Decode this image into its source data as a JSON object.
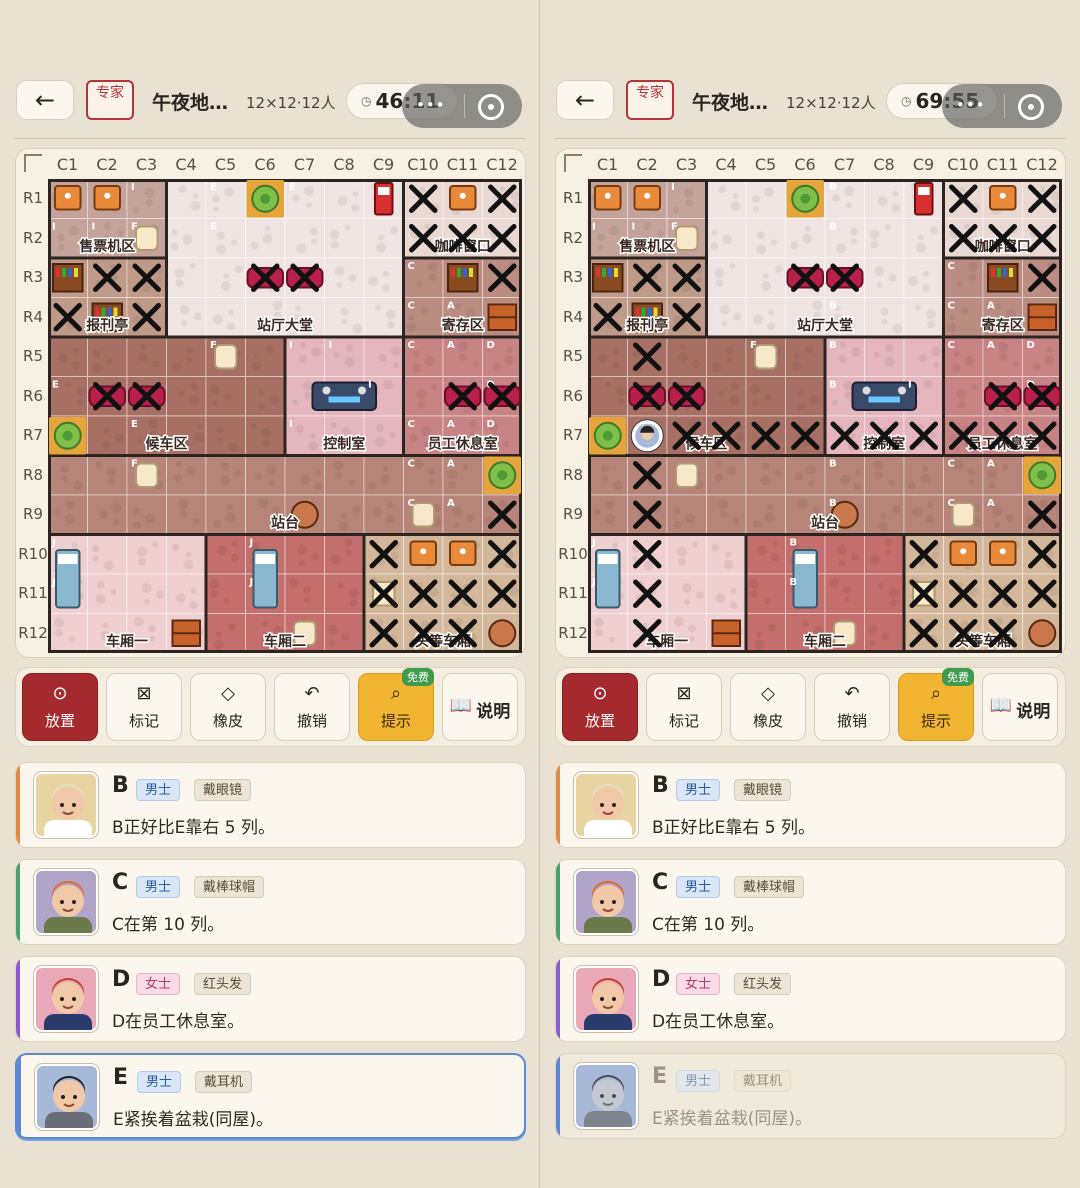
{
  "header": {
    "back_icon": "←",
    "difficulty": "专家",
    "title": "午夜地…",
    "size": "12×12·12人",
    "menu_dots": "•••"
  },
  "left": {
    "timer": "46:11"
  },
  "right": {
    "timer": "69:55"
  },
  "columns": [
    "C1",
    "C2",
    "C3",
    "C4",
    "C5",
    "C6",
    "C7",
    "C8",
    "C9",
    "C10",
    "C11",
    "C12"
  ],
  "rows": [
    "R1",
    "R2",
    "R3",
    "R4",
    "R5",
    "R6",
    "R7",
    "R8",
    "R9",
    "R10",
    "R11",
    "R12"
  ],
  "regions": [
    {
      "name": "售票机区",
      "color": "#c4a39a",
      "cells": [
        [
          0,
          0
        ],
        [
          1,
          0
        ],
        [
          2,
          0
        ],
        [
          0,
          1
        ],
        [
          1,
          1
        ],
        [
          2,
          1
        ]
      ]
    },
    {
      "name": "报刊亭",
      "color": "#c09a88",
      "cells": [
        [
          0,
          2
        ],
        [
          1,
          2
        ],
        [
          2,
          2
        ],
        [
          0,
          3
        ],
        [
          1,
          3
        ],
        [
          2,
          3
        ]
      ]
    },
    {
      "name": "站厅大堂",
      "color": "#f0e4e2",
      "cells": [
        [
          3,
          0
        ],
        [
          4,
          0
        ],
        [
          5,
          0
        ],
        [
          6,
          0
        ],
        [
          7,
          0
        ],
        [
          8,
          0
        ],
        [
          3,
          1
        ],
        [
          4,
          1
        ],
        [
          5,
          1
        ],
        [
          6,
          1
        ],
        [
          7,
          1
        ],
        [
          8,
          1
        ],
        [
          3,
          2
        ],
        [
          4,
          2
        ],
        [
          5,
          2
        ],
        [
          6,
          2
        ],
        [
          7,
          2
        ],
        [
          8,
          2
        ],
        [
          3,
          3
        ],
        [
          4,
          3
        ],
        [
          5,
          3
        ],
        [
          6,
          3
        ],
        [
          7,
          3
        ],
        [
          8,
          3
        ]
      ]
    },
    {
      "name": "咖啡窗口",
      "color": "#ead8d2",
      "cells": [
        [
          9,
          0
        ],
        [
          10,
          0
        ],
        [
          11,
          0
        ],
        [
          9,
          1
        ],
        [
          10,
          1
        ],
        [
          11,
          1
        ]
      ]
    },
    {
      "name": "寄存区",
      "color": "#bb8d82",
      "cells": [
        [
          9,
          2
        ],
        [
          10,
          2
        ],
        [
          11,
          2
        ],
        [
          9,
          3
        ],
        [
          10,
          3
        ],
        [
          11,
          3
        ]
      ]
    },
    {
      "name": "候车区",
      "color": "#a87065",
      "cells": [
        [
          0,
          4
        ],
        [
          1,
          4
        ],
        [
          2,
          4
        ],
        [
          3,
          4
        ],
        [
          4,
          4
        ],
        [
          5,
          4
        ],
        [
          0,
          5
        ],
        [
          1,
          5
        ],
        [
          2,
          5
        ],
        [
          3,
          5
        ],
        [
          4,
          5
        ],
        [
          5,
          5
        ],
        [
          0,
          6
        ],
        [
          1,
          6
        ],
        [
          2,
          6
        ],
        [
          3,
          6
        ],
        [
          4,
          6
        ],
        [
          5,
          6
        ]
      ]
    },
    {
      "name": "控制室",
      "color": "#e5b6be",
      "cells": [
        [
          6,
          4
        ],
        [
          7,
          4
        ],
        [
          8,
          4
        ],
        [
          6,
          5
        ],
        [
          7,
          5
        ],
        [
          8,
          5
        ],
        [
          6,
          6
        ],
        [
          7,
          6
        ],
        [
          8,
          6
        ]
      ]
    },
    {
      "name": "员工休息室",
      "color": "#c88384",
      "cells": [
        [
          9,
          4
        ],
        [
          10,
          4
        ],
        [
          11,
          4
        ],
        [
          9,
          5
        ],
        [
          10,
          5
        ],
        [
          11,
          5
        ],
        [
          9,
          6
        ],
        [
          10,
          6
        ],
        [
          11,
          6
        ]
      ]
    },
    {
      "name": "站台",
      "color": "#b68478",
      "cells": [
        [
          0,
          7
        ],
        [
          1,
          7
        ],
        [
          2,
          7
        ],
        [
          3,
          7
        ],
        [
          4,
          7
        ],
        [
          5,
          7
        ],
        [
          6,
          7
        ],
        [
          7,
          7
        ],
        [
          8,
          7
        ],
        [
          9,
          7
        ],
        [
          10,
          7
        ],
        [
          11,
          7
        ],
        [
          0,
          8
        ],
        [
          1,
          8
        ],
        [
          2,
          8
        ],
        [
          3,
          8
        ],
        [
          4,
          8
        ],
        [
          5,
          8
        ],
        [
          6,
          8
        ],
        [
          7,
          8
        ],
        [
          8,
          8
        ],
        [
          9,
          8
        ],
        [
          10,
          8
        ],
        [
          11,
          8
        ]
      ]
    },
    {
      "name": "车厢一",
      "color": "#efcfd0",
      "cells": [
        [
          0,
          9
        ],
        [
          1,
          9
        ],
        [
          2,
          9
        ],
        [
          3,
          9
        ],
        [
          0,
          10
        ],
        [
          1,
          10
        ],
        [
          2,
          10
        ],
        [
          3,
          10
        ],
        [
          0,
          11
        ],
        [
          1,
          11
        ],
        [
          2,
          11
        ],
        [
          3,
          11
        ]
      ]
    },
    {
      "name": "车厢二",
      "color": "#c46e6e",
      "cells": [
        [
          4,
          9
        ],
        [
          5,
          9
        ],
        [
          6,
          9
        ],
        [
          7,
          9
        ],
        [
          4,
          10
        ],
        [
          5,
          10
        ],
        [
          6,
          10
        ],
        [
          7,
          10
        ],
        [
          4,
          11
        ],
        [
          5,
          11
        ],
        [
          6,
          11
        ],
        [
          7,
          11
        ]
      ]
    },
    {
      "name": "头等车厢",
      "color": "#d2b79a",
      "cells": [
        [
          8,
          9
        ],
        [
          9,
          9
        ],
        [
          10,
          9
        ],
        [
          11,
          9
        ],
        [
          8,
          10
        ],
        [
          9,
          10
        ],
        [
          10,
          10
        ],
        [
          11,
          10
        ],
        [
          8,
          11
        ],
        [
          9,
          11
        ],
        [
          10,
          11
        ],
        [
          11,
          11
        ]
      ]
    }
  ],
  "objects": [
    {
      "type": "table",
      "c": 0,
      "r": 0
    },
    {
      "type": "table",
      "c": 1,
      "r": 0
    },
    {
      "type": "plant",
      "c": 5,
      "r": 0
    },
    {
      "type": "machine",
      "c": 8,
      "r": 0
    },
    {
      "type": "table",
      "c": 10,
      "r": 0
    },
    {
      "type": "chair",
      "c": 2,
      "r": 1
    },
    {
      "type": "shelf",
      "c": 0,
      "r": 2
    },
    {
      "type": "shelf",
      "c": 10,
      "r": 2
    },
    {
      "type": "sofa",
      "c": 5,
      "r": 2
    },
    {
      "type": "sofa",
      "c": 6,
      "r": 2
    },
    {
      "type": "crate",
      "c": 11,
      "r": 3
    },
    {
      "type": "shelf",
      "c": 1,
      "r": 3
    },
    {
      "type": "chair",
      "c": 4,
      "r": 4
    },
    {
      "type": "sofa",
      "c": 1,
      "r": 5
    },
    {
      "type": "sofa",
      "c": 2,
      "r": 5
    },
    {
      "type": "panel",
      "c": 7,
      "r": 5
    },
    {
      "type": "sofa",
      "c": 10,
      "r": 5
    },
    {
      "type": "sofa",
      "c": 11,
      "r": 5
    },
    {
      "type": "plant",
      "c": 0,
      "r": 6
    },
    {
      "type": "chair",
      "c": 2,
      "r": 7
    },
    {
      "type": "plant",
      "c": 11,
      "r": 7
    },
    {
      "type": "barrel",
      "c": 6,
      "r": 8
    },
    {
      "type": "chair",
      "c": 9,
      "r": 8
    },
    {
      "type": "bed",
      "c": 0,
      "r": 10
    },
    {
      "type": "bed",
      "c": 5,
      "r": 10
    },
    {
      "type": "table",
      "c": 9,
      "r": 9
    },
    {
      "type": "table",
      "c": 10,
      "r": 9
    },
    {
      "type": "chair",
      "c": 8,
      "r": 10
    },
    {
      "type": "crate",
      "c": 3,
      "r": 11
    },
    {
      "type": "chair",
      "c": 6,
      "r": 11
    },
    {
      "type": "barrel",
      "c": 11,
      "r": 11
    }
  ],
  "left_marks": [
    [
      9,
      0
    ],
    [
      11,
      0
    ],
    [
      9,
      1
    ],
    [
      10,
      1
    ],
    [
      11,
      1
    ],
    [
      1,
      2
    ],
    [
      2,
      2
    ],
    [
      5,
      2
    ],
    [
      6,
      2
    ],
    [
      11,
      2
    ],
    [
      0,
      3
    ],
    [
      2,
      3
    ],
    [
      1,
      5
    ],
    [
      2,
      5
    ],
    [
      10,
      5
    ],
    [
      11,
      5
    ],
    [
      11,
      8
    ],
    [
      8,
      9
    ],
    [
      11,
      9
    ],
    [
      8,
      10
    ],
    [
      9,
      10
    ],
    [
      10,
      10
    ],
    [
      11,
      10
    ],
    [
      8,
      11
    ],
    [
      9,
      11
    ],
    [
      10,
      11
    ]
  ],
  "right_marks": [
    [
      9,
      0
    ],
    [
      11,
      0
    ],
    [
      9,
      1
    ],
    [
      10,
      1
    ],
    [
      11,
      1
    ],
    [
      1,
      2
    ],
    [
      2,
      2
    ],
    [
      5,
      2
    ],
    [
      6,
      2
    ],
    [
      11,
      2
    ],
    [
      0,
      3
    ],
    [
      2,
      3
    ],
    [
      1,
      4
    ],
    [
      1,
      5
    ],
    [
      2,
      5
    ],
    [
      10,
      5
    ],
    [
      11,
      5
    ],
    [
      2,
      6
    ],
    [
      3,
      6
    ],
    [
      4,
      6
    ],
    [
      5,
      6
    ],
    [
      6,
      6
    ],
    [
      7,
      6
    ],
    [
      8,
      6
    ],
    [
      9,
      6
    ],
    [
      10,
      6
    ],
    [
      11,
      6
    ],
    [
      1,
      7
    ],
    [
      1,
      8
    ],
    [
      11,
      8
    ],
    [
      1,
      9
    ],
    [
      8,
      9
    ],
    [
      11,
      9
    ],
    [
      1,
      10
    ],
    [
      8,
      10
    ],
    [
      9,
      10
    ],
    [
      10,
      10
    ],
    [
      11,
      10
    ],
    [
      1,
      11
    ],
    [
      8,
      11
    ],
    [
      9,
      11
    ],
    [
      10,
      11
    ]
  ],
  "left_letters": [
    [
      2,
      0,
      "I"
    ],
    [
      4,
      0,
      "E"
    ],
    [
      6,
      0,
      "E"
    ],
    [
      0,
      1,
      "I"
    ],
    [
      1,
      1,
      "I"
    ],
    [
      2,
      1,
      "F"
    ],
    [
      4,
      1,
      "E"
    ],
    [
      9,
      2,
      "C"
    ],
    [
      9,
      3,
      "C"
    ],
    [
      10,
      3,
      "A"
    ],
    [
      4,
      4,
      "F"
    ],
    [
      6,
      4,
      "I"
    ],
    [
      7,
      4,
      "I"
    ],
    [
      9,
      4,
      "C"
    ],
    [
      10,
      4,
      "A"
    ],
    [
      11,
      4,
      "D"
    ],
    [
      0,
      5,
      "E"
    ],
    [
      8,
      5,
      "I"
    ],
    [
      11,
      5,
      "D"
    ],
    [
      2,
      6,
      "E"
    ],
    [
      6,
      6,
      "I"
    ],
    [
      9,
      6,
      "C"
    ],
    [
      10,
      6,
      "A"
    ],
    [
      11,
      6,
      "D"
    ],
    [
      2,
      7,
      "F"
    ],
    [
      9,
      7,
      "C"
    ],
    [
      10,
      7,
      "A"
    ],
    [
      9,
      8,
      "C"
    ],
    [
      10,
      8,
      "A"
    ],
    [
      0,
      9,
      "J"
    ],
    [
      5,
      9,
      "J"
    ],
    [
      0,
      10,
      "J"
    ],
    [
      5,
      10,
      "J"
    ]
  ],
  "right_letters": [
    [
      2,
      0,
      "I"
    ],
    [
      6,
      0,
      "B"
    ],
    [
      0,
      1,
      "I"
    ],
    [
      1,
      1,
      "I"
    ],
    [
      2,
      1,
      "F"
    ],
    [
      6,
      1,
      "B"
    ],
    [
      9,
      2,
      "C"
    ],
    [
      6,
      3,
      "B"
    ],
    [
      9,
      3,
      "C"
    ],
    [
      10,
      3,
      "A"
    ],
    [
      4,
      4,
      "F"
    ],
    [
      6,
      4,
      "B"
    ],
    [
      9,
      4,
      "C"
    ],
    [
      10,
      4,
      "A"
    ],
    [
      11,
      4,
      "D"
    ],
    [
      6,
      5,
      "B"
    ],
    [
      8,
      5,
      "I"
    ],
    [
      11,
      5,
      "D"
    ],
    [
      6,
      7,
      "B"
    ],
    [
      9,
      7,
      "C"
    ],
    [
      10,
      7,
      "A"
    ],
    [
      6,
      8,
      "B"
    ],
    [
      9,
      8,
      "C"
    ],
    [
      10,
      8,
      "A"
    ],
    [
      0,
      9,
      "J"
    ],
    [
      5,
      9,
      "B"
    ],
    [
      0,
      10,
      "J"
    ],
    [
      5,
      10,
      "B"
    ]
  ],
  "right_avatar": {
    "c": 1,
    "r": 6
  },
  "toolbar": [
    {
      "key": "place",
      "label": "放置",
      "icon": "⊙"
    },
    {
      "key": "mark",
      "label": "标记",
      "icon": "⊠"
    },
    {
      "key": "eraser",
      "label": "橡皮",
      "icon": "◇"
    },
    {
      "key": "undo",
      "label": "撤销",
      "icon": "↶"
    },
    {
      "key": "hint",
      "label": "提示",
      "icon": "⌕",
      "badge": "免费"
    },
    {
      "key": "help",
      "label": "说明",
      "icon": "📖"
    }
  ],
  "suspects": [
    {
      "name": "B",
      "gender": "男士",
      "attr": "戴眼镜",
      "clue": "B正好比E靠右 5 列。",
      "bar": "#e08a4a",
      "hair": "#e8dcc8",
      "skin": "#f2c9a8",
      "shirt": "#ffffff",
      "bg": "#e8d4a0"
    },
    {
      "name": "C",
      "gender": "男士",
      "attr": "戴棒球帽",
      "clue": "C在第 10 列。",
      "bar": "#4aa06a",
      "hair": "#e06a2a",
      "skin": "#f2c9a8",
      "shirt": "#6a7a4a",
      "bg": "#b0a4c8"
    },
    {
      "name": "D",
      "gender": "女士",
      "attr": "红头发",
      "clue": "D在员工休息室。",
      "bar": "#8a5ad0",
      "hair": "#c0402a",
      "skin": "#f2c9a8",
      "shirt": "#2a3a6a",
      "bg": "#e8a8b8"
    },
    {
      "name": "E",
      "gender": "男士",
      "attr": "戴耳机",
      "clue": "E紧挨着盆栽(同屋)。",
      "bar": "#5a87d6",
      "hair": "#222222",
      "skin": "#f2c9a8",
      "shirt": "#6a6e78",
      "bg": "#a8b8d8"
    }
  ]
}
